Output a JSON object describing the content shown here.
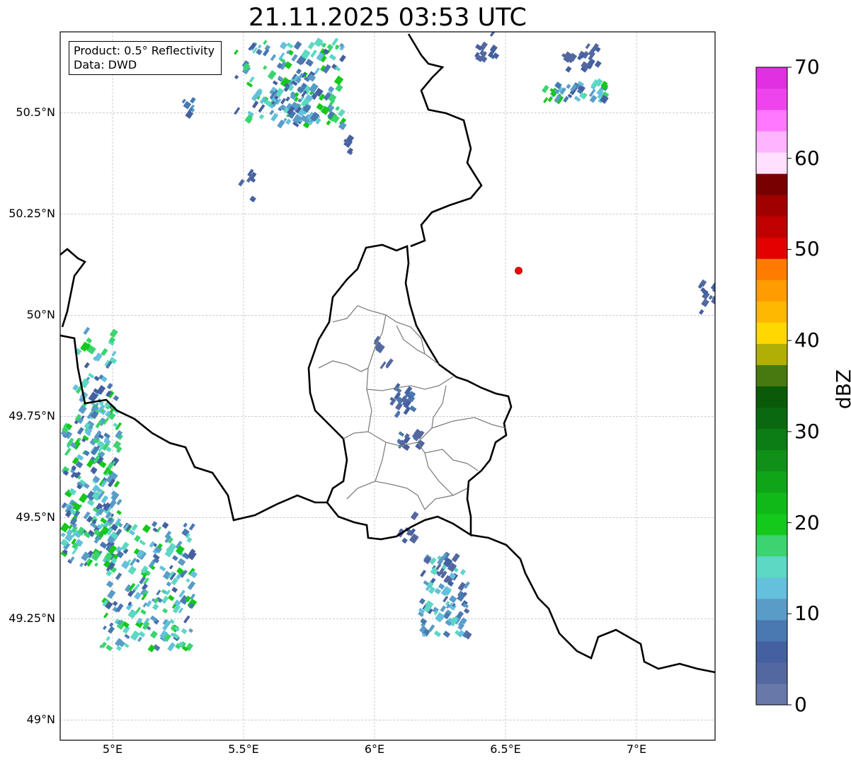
{
  "title": "21.11.2025 03:53 UTC",
  "info": {
    "product_line": "Product: 0.5° Reflectivity",
    "data_line": "Data: DWD"
  },
  "axes": {
    "lat_labels": [
      {
        "value": 50.5,
        "label": "50.5°N"
      },
      {
        "value": 50.25,
        "label": "50.25°N"
      },
      {
        "value": 50.0,
        "label": "50°N"
      },
      {
        "value": 49.75,
        "label": "49.75°N"
      },
      {
        "value": 49.5,
        "label": "49.5°N"
      },
      {
        "value": 49.25,
        "label": "49.25°N"
      },
      {
        "value": 49.0,
        "label": "49°N"
      }
    ],
    "lon_labels": [
      {
        "value": 5.0,
        "label": "5°E"
      },
      {
        "value": 5.5,
        "label": "5.5°E"
      },
      {
        "value": 6.0,
        "label": "6°E"
      },
      {
        "value": 6.5,
        "label": "6.5°E"
      },
      {
        "value": 7.0,
        "label": "7°E"
      }
    ],
    "lon_range": [
      4.8,
      7.3
    ],
    "lat_range": [
      48.95,
      50.7
    ]
  },
  "colorbar": {
    "label": "dBZ",
    "min": 0,
    "max": 70,
    "ticks": [
      {
        "value": 0,
        "label": "0"
      },
      {
        "value": 10,
        "label": "10"
      },
      {
        "value": 20,
        "label": "20"
      },
      {
        "value": 30,
        "label": "30"
      },
      {
        "value": 40,
        "label": "40"
      },
      {
        "value": 50,
        "label": "50"
      },
      {
        "value": 60,
        "label": "60"
      },
      {
        "value": 70,
        "label": "70"
      }
    ],
    "colors": [
      "#6878a8",
      "#5468a0",
      "#4460a0",
      "#4a78b0",
      "#5a9cc8",
      "#64c0dc",
      "#5cd8c4",
      "#3cd470",
      "#14c81c",
      "#10b818",
      "#10a418",
      "#109018",
      "#0c7c14",
      "#0a6810",
      "#0a5a0a",
      "#487810",
      "#b0b004",
      "#ffd800",
      "#ffb800",
      "#ff9c00",
      "#ff7c00",
      "#e40000",
      "#c00000",
      "#a00000",
      "#780000",
      "#ffe0ff",
      "#ffb4ff",
      "#ff78ff",
      "#ee44ee",
      "#e030e0"
    ]
  },
  "marker": {
    "lon": 6.55,
    "lat": 50.11,
    "color": "#ff0000"
  },
  "colors": {
    "border": "#000000",
    "admin": "#808080",
    "grid": "#b0b0b0"
  }
}
